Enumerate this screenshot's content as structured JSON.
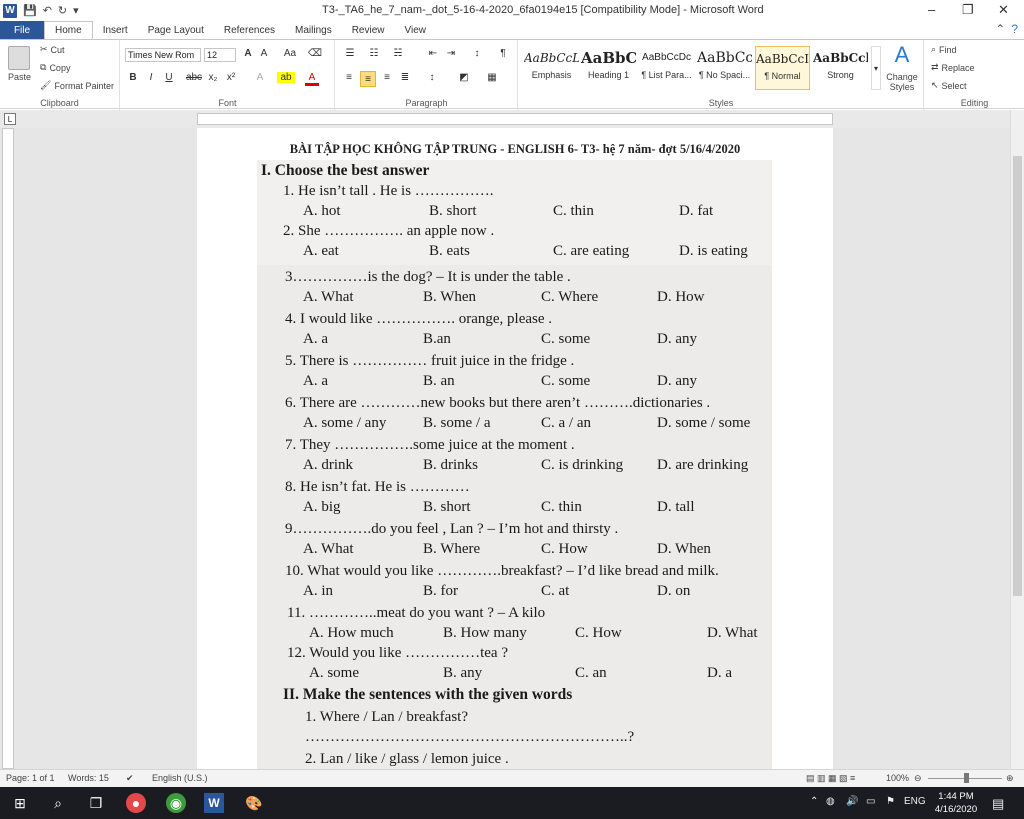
{
  "window": {
    "title": "T3-_TA6_he_7_nam-_dot_5-16-4-2020_6fa0194e15 [Compatibility Mode] - Microsoft Word",
    "minimize": "–",
    "restore": "❐",
    "close": "✕"
  },
  "tabs": [
    "File",
    "Home",
    "Insert",
    "Page Layout",
    "References",
    "Mailings",
    "Review",
    "View"
  ],
  "ribbon": {
    "clipboard": {
      "label": "Clipboard",
      "paste": "Paste",
      "cut": "Cut",
      "copy": "Copy",
      "format_painter": "Format Painter"
    },
    "font": {
      "label": "Font",
      "name": "Times New Rom",
      "size": "12"
    },
    "paragraph": {
      "label": "Paragraph"
    },
    "styles": {
      "label": "Styles",
      "items": [
        {
          "preview": "AaBbCcL",
          "name": "Emphasis"
        },
        {
          "preview": "AaBbC",
          "name": "Heading 1"
        },
        {
          "preview": "AaBbCcDc",
          "name": "¶ List Para..."
        },
        {
          "preview": "AaBbCc",
          "name": "¶ No Spaci..."
        },
        {
          "preview": "AaBbCcI",
          "name": "¶ Normal"
        },
        {
          "preview": "AaBbCcl",
          "name": "Strong"
        }
      ],
      "change_styles": "Change Styles"
    },
    "editing": {
      "label": "Editing",
      "find": "Find",
      "replace": "Replace",
      "select": "Select"
    }
  },
  "document": {
    "title": "BÀI TẬP HỌC KHÔNG TẬP TRUNG - ENGLISH 6- T3- hệ 7 năm- đợt 5/16/4/2020",
    "lines": [
      "I. Choose the best answer",
      "1. He isn’t tall . He is …………….",
      "A. hot",
      "B. short",
      "C. thin",
      "D. fat",
      "2. She ……………. an apple now .",
      "A. eat",
      "B. eats",
      "C. are eating",
      "D. is eating",
      "3……………is the dog? – It is under the table .",
      "A. What",
      "B. When",
      "C. Where",
      "D. How",
      "4. I would like ……………. orange, please .",
      "A. a",
      "B.an",
      "C. some",
      "D. any",
      "5. There is …………… fruit juice in the fridge .",
      "A. a",
      "B. an",
      "C. some",
      "D. any",
      "6. There are …………new books but there aren’t ……….dictionaries .",
      "A. some / any",
      "B. some / a",
      "C. a / an",
      "D. some / some",
      "7. They …………….some juice at the moment .",
      "A. drink",
      "B. drinks",
      "C. is drinking",
      "D. are drinking",
      "8. He isn’t fat. He is …………",
      "A. big",
      "B. short",
      "C. thin",
      "D. tall",
      "9…………….do you feel , Lan ? – I’m hot and thirsty .",
      "A. What",
      "B. Where",
      "C. How",
      "D. When",
      "10. What would you like ………….breakfast? – I’d like bread and milk.",
      "A. in",
      "B. for",
      "C. at",
      "D. on",
      "11. …………..meat do you want ? – A kilo",
      "A. How much",
      "B. How many",
      "C. How",
      "D. What",
      "12. Would you like ……………tea ?",
      "A. some",
      "B. any",
      "C. an",
      "D. a",
      "II. Make the sentences with the given words",
      "1. Where / Lan / breakfast?",
      "………………………………………………………..?",
      "2. Lan / like / glass / lemon juice ."
    ]
  },
  "status": {
    "page": "Page: 1 of 1",
    "words": "Words: 15",
    "language": "English (U.S.)",
    "zoom": "100%"
  },
  "taskbar": {
    "lang": "ENG",
    "time": "1:44 PM",
    "date": "4/16/2020"
  }
}
